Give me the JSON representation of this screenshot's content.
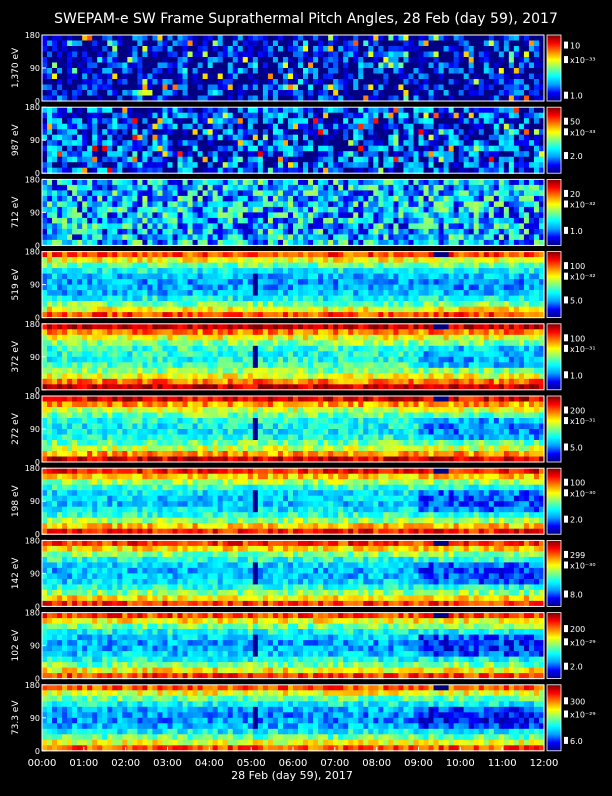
{
  "chart_data": {
    "type": "heatmap",
    "title": "SWEPAM-e SW Frame Suprathermal Pitch Angles, 28 Feb (day  59), 2017",
    "xlabel": "28 Feb (day  59), 2017",
    "x_ticks": [
      "00:00",
      "01:00",
      "02:00",
      "03:00",
      "04:00",
      "05:00",
      "06:00",
      "07:00",
      "08:00",
      "09:00",
      "10:00",
      "11:00",
      "12:00"
    ],
    "x_range_hours": [
      0,
      12
    ],
    "y_ticks": [
      "0",
      "90",
      "180"
    ],
    "y_range_deg": [
      0,
      180
    ],
    "colormap": [
      "#000080",
      "#0000ff",
      "#00a0ff",
      "#00ffff",
      "#80ff80",
      "#ffff00",
      "#ff8000",
      "#ff0000",
      "#800000"
    ],
    "panels": [
      {
        "energy_label": "1,370 eV",
        "scale_labels": [
          {
            "text": "10",
            "pos": 0.16
          },
          {
            "text": "x10⁻³³",
            "pos": 0.38
          },
          {
            "text": "1.0",
            "pos": 0.92
          }
        ],
        "intensity": 0.05
      },
      {
        "energy_label": "987 eV",
        "scale_labels": [
          {
            "text": "50",
            "pos": 0.22
          },
          {
            "text": "x10⁻³³",
            "pos": 0.38
          },
          {
            "text": "2.0",
            "pos": 0.74
          }
        ],
        "intensity": 0.15
      },
      {
        "energy_label": "712 eV",
        "scale_labels": [
          {
            "text": "20",
            "pos": 0.22
          },
          {
            "text": "x10⁻³²",
            "pos": 0.38
          },
          {
            "text": "1.0",
            "pos": 0.78
          }
        ],
        "intensity": 0.3
      },
      {
        "energy_label": "519 eV",
        "scale_labels": [
          {
            "text": "100",
            "pos": 0.22
          },
          {
            "text": "x10⁻³²",
            "pos": 0.38
          },
          {
            "text": "5.0",
            "pos": 0.74
          }
        ],
        "intensity": 0.45
      },
      {
        "energy_label": "372 eV",
        "scale_labels": [
          {
            "text": "100",
            "pos": 0.22
          },
          {
            "text": "x10⁻³¹",
            "pos": 0.38
          },
          {
            "text": "1.0",
            "pos": 0.78
          }
        ],
        "intensity": 0.58
      },
      {
        "energy_label": "272 eV",
        "scale_labels": [
          {
            "text": "200",
            "pos": 0.22
          },
          {
            "text": "x10⁻³¹",
            "pos": 0.38
          },
          {
            "text": "5.0",
            "pos": 0.78
          }
        ],
        "intensity": 0.55
      },
      {
        "energy_label": "198 eV",
        "scale_labels": [
          {
            "text": "100",
            "pos": 0.22
          },
          {
            "text": "x10⁻³⁰",
            "pos": 0.38
          },
          {
            "text": "2.0",
            "pos": 0.78
          }
        ],
        "intensity": 0.5
      },
      {
        "energy_label": "142 eV",
        "scale_labels": [
          {
            "text": "299",
            "pos": 0.22
          },
          {
            "text": "x10⁻³⁰",
            "pos": 0.38
          },
          {
            "text": "8.0",
            "pos": 0.82
          }
        ],
        "intensity": 0.48
      },
      {
        "energy_label": "102 eV",
        "scale_labels": [
          {
            "text": "200",
            "pos": 0.25
          },
          {
            "text": "x10⁻²⁹",
            "pos": 0.45
          },
          {
            "text": "2.0",
            "pos": 0.82
          }
        ],
        "intensity": 0.46
      },
      {
        "energy_label": "73.3 eV",
        "scale_labels": [
          {
            "text": "300",
            "pos": 0.25
          },
          {
            "text": "x10⁻²⁹",
            "pos": 0.45
          },
          {
            "text": "6.0",
            "pos": 0.85
          }
        ],
        "intensity": 0.44
      }
    ],
    "dropouts_hours": [
      9.3,
      9.45
    ],
    "dark_column_hour": 5.05
  }
}
